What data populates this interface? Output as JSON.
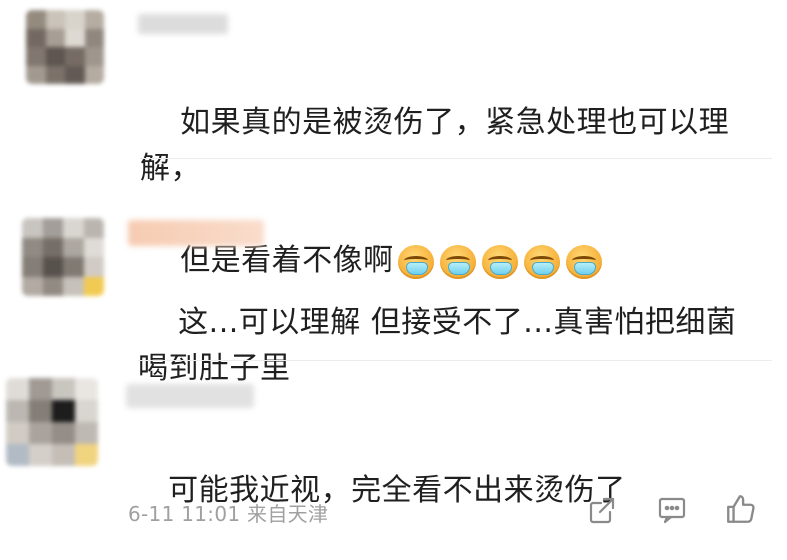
{
  "comments": [
    {
      "text_line_1": "如果真的是被烫伤了，紧急处理也可以理解，",
      "text_line_2": "但是看着不像啊",
      "emoji_icon": "vomit-face-emoji",
      "emoji_count": 5
    },
    {
      "text": "这...可以理解 但接受不了...真害怕把细菌喝到肚子里"
    },
    {
      "text": "可能我近视，完全看不出来烫伤了",
      "meta": "6-11 11:01 来自天津"
    }
  ],
  "actions": {
    "share_icon": "share-icon",
    "comment_icon": "comment-icon",
    "like_icon": "thumbs-up-icon"
  }
}
